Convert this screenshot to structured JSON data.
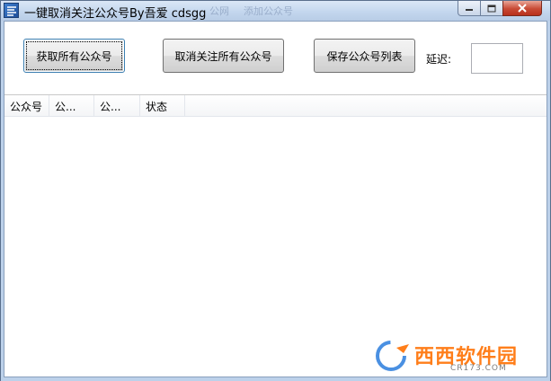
{
  "window": {
    "title": "一键取消关注公众号By吾爱 cdsgg",
    "ghost_tabs": [
      "公网",
      "添加公众号"
    ]
  },
  "toolbar": {
    "fetch_all_label": "获取所有公众号",
    "unfollow_all_label": "取消关注所有公众号",
    "save_list_label": "保存公众号列表",
    "delay_label": "延迟:",
    "delay_value": ""
  },
  "list": {
    "columns": [
      "公众号",
      "公...",
      "公...",
      "状态"
    ],
    "rows": []
  },
  "watermark": {
    "brand": "西西软件园",
    "site": "CR173.COM"
  },
  "colors": {
    "titlebar": "#c4d7ee",
    "close_button": "#c84a35",
    "watermark_orange": "#ff7e1a"
  },
  "icons": {
    "app": "app-icon",
    "minimize": "minimize-icon",
    "maximize": "maximize-icon",
    "close": "close-icon"
  }
}
